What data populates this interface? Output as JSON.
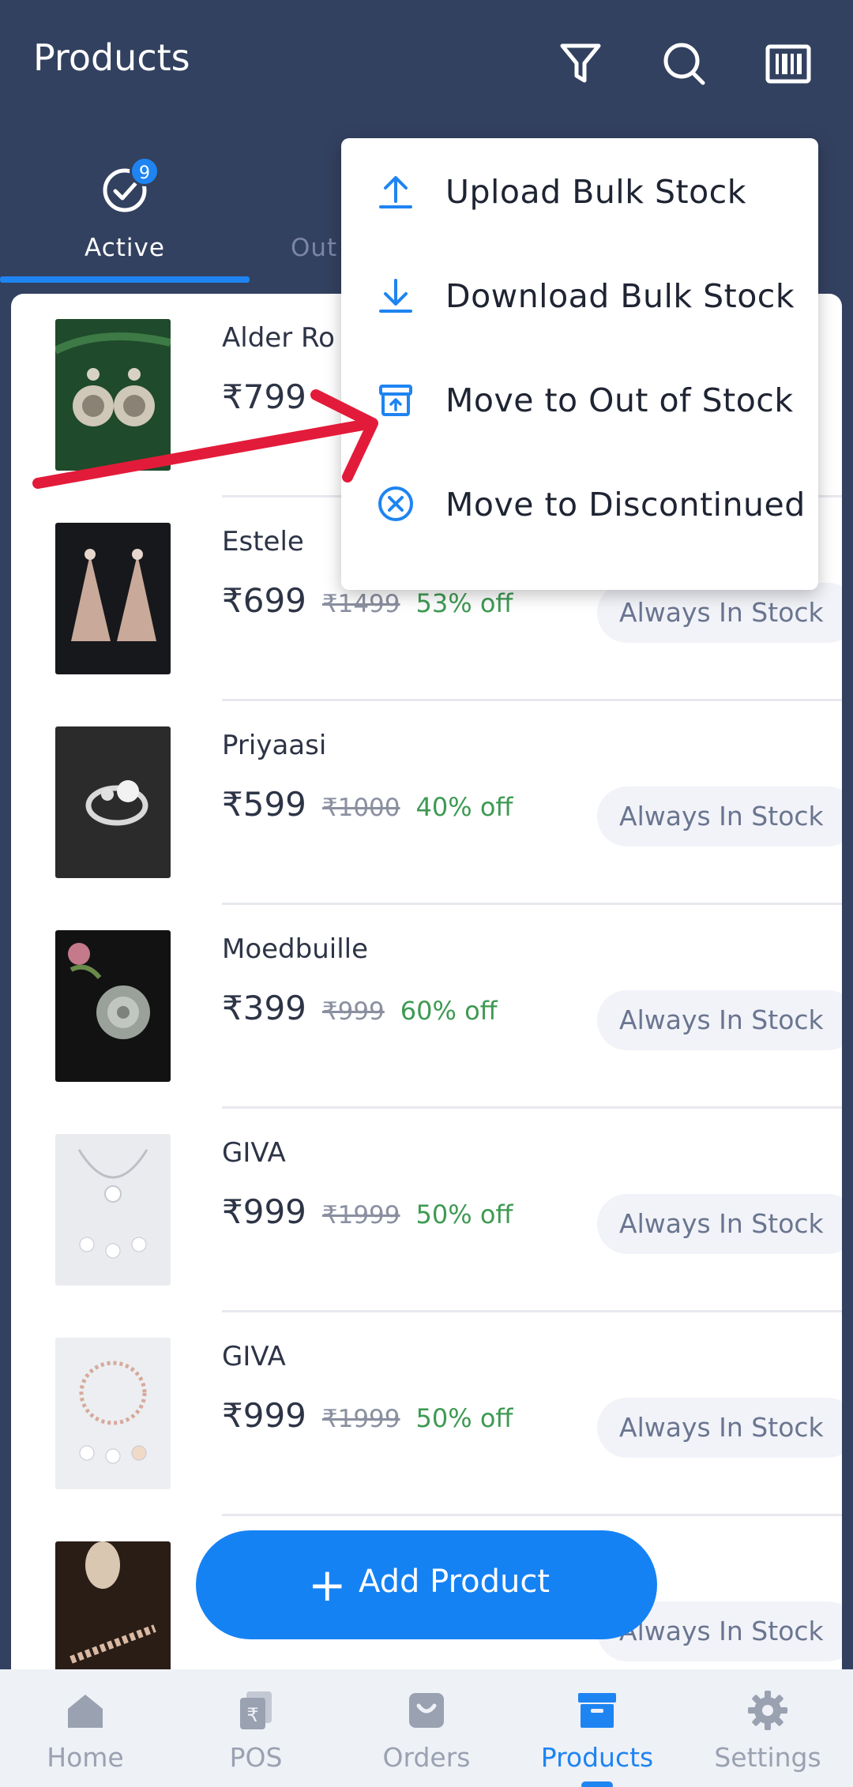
{
  "header": {
    "title": "Products"
  },
  "tabs": [
    {
      "label": "Active",
      "badge": "9"
    },
    {
      "label": "Out"
    }
  ],
  "menu": {
    "items": [
      {
        "label": "Upload Bulk Stock",
        "icon": "upload-icon"
      },
      {
        "label": "Download Bulk Stock",
        "icon": "download-icon"
      },
      {
        "label": "Move to Out of Stock",
        "icon": "archive-up-icon"
      },
      {
        "label": "Move to Discontinued",
        "icon": "close-circle-icon"
      }
    ]
  },
  "products": [
    {
      "name": "Alder Ro",
      "price": "₹799",
      "mrp": "",
      "off": "",
      "stock": ""
    },
    {
      "name": "Estele",
      "price": "₹699",
      "mrp": "₹1499",
      "off": "53% off",
      "stock": "Always In Stock"
    },
    {
      "name": "Priyaasi",
      "price": "₹599",
      "mrp": "₹1000",
      "off": "40% off",
      "stock": "Always In Stock"
    },
    {
      "name": "Moedbuille",
      "price": "₹399",
      "mrp": "₹999",
      "off": "60% off",
      "stock": "Always In Stock"
    },
    {
      "name": "GIVA",
      "price": "₹999",
      "mrp": "₹1999",
      "off": "50% off",
      "stock": "Always In Stock"
    },
    {
      "name": "GIVA",
      "price": "₹999",
      "mrp": "₹1999",
      "off": "50% off",
      "stock": "Always In Stock"
    },
    {
      "name": "",
      "price": "",
      "mrp": "",
      "off": "",
      "stock": "Always In Stock"
    }
  ],
  "fab": {
    "label": "Add Product"
  },
  "nav": [
    {
      "label": "Home",
      "icon": "home-icon"
    },
    {
      "label": "POS",
      "icon": "pos-icon"
    },
    {
      "label": "Orders",
      "icon": "bag-icon"
    },
    {
      "label": "Products",
      "icon": "box-icon"
    },
    {
      "label": "Settings",
      "icon": "gear-icon"
    }
  ],
  "colors": {
    "header": "#334160",
    "accent": "#1e84f2",
    "discount": "#3e9a52",
    "annotation": "#e31b3a"
  }
}
